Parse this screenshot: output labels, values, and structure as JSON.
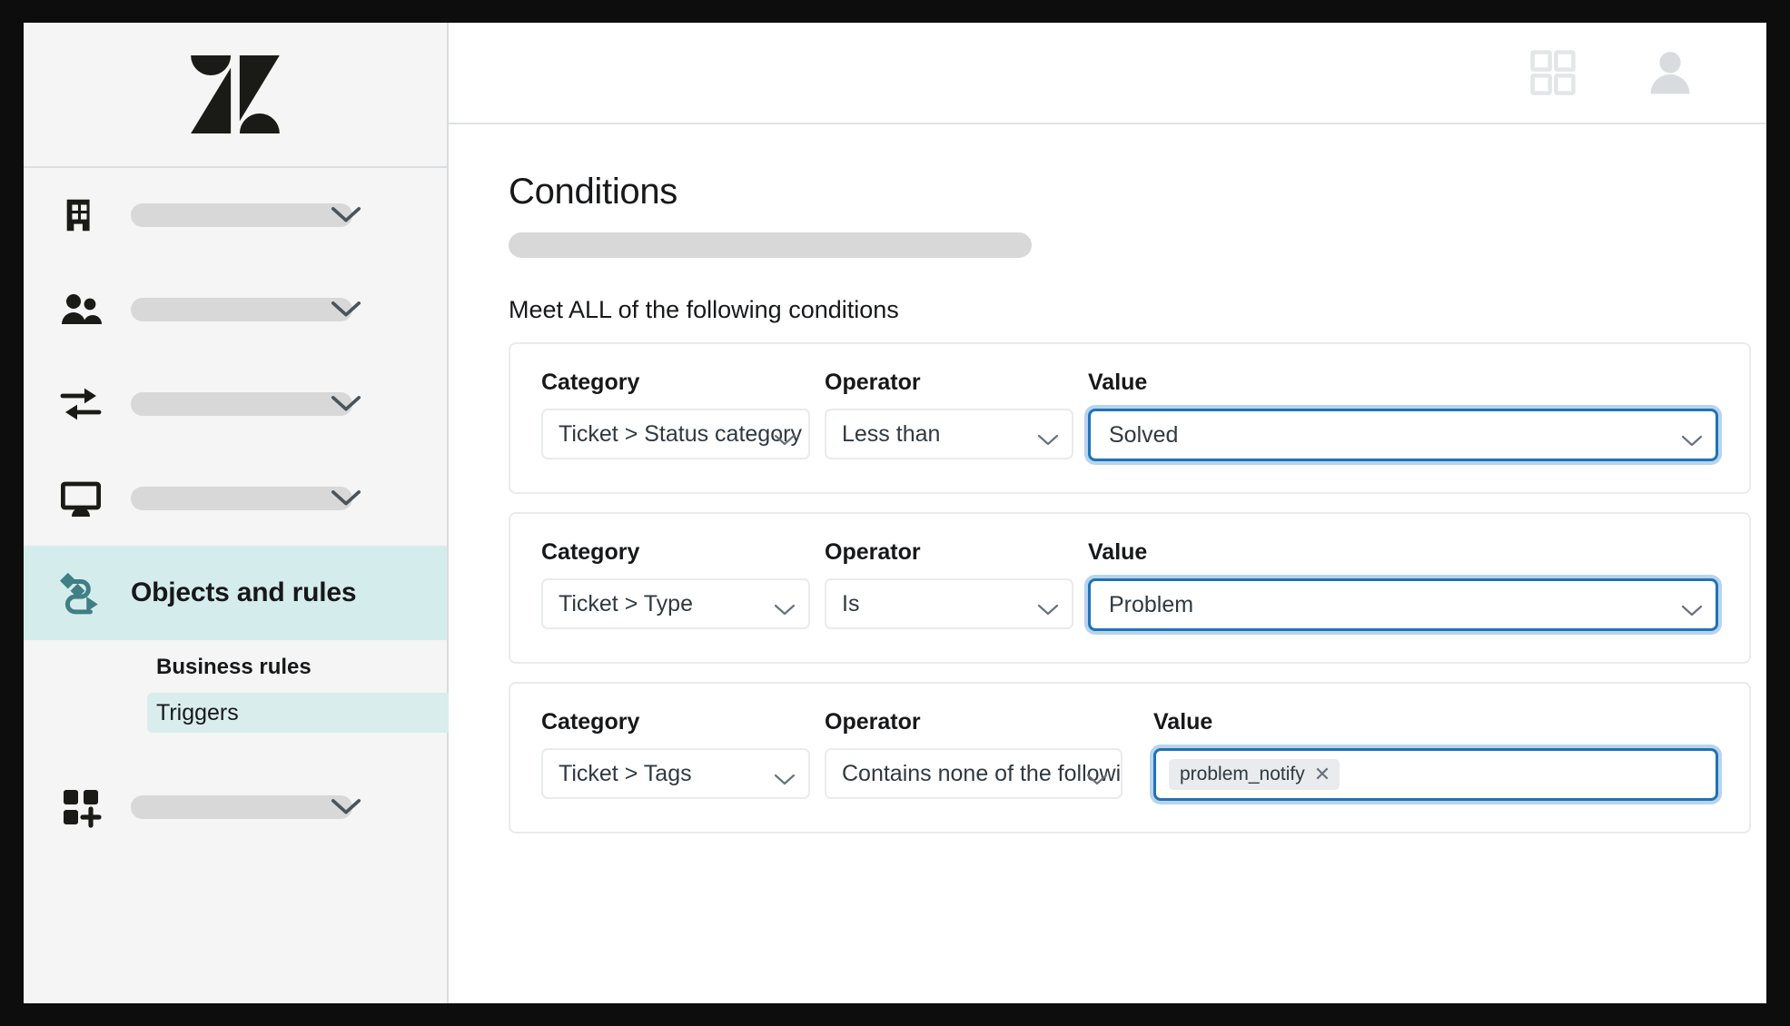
{
  "sidebar": {
    "logo": "zendesk-logo",
    "nav_items": [
      {
        "icon": "building-icon",
        "label": "",
        "skeleton": true,
        "chevron": true,
        "active": false
      },
      {
        "icon": "people-icon",
        "label": "",
        "skeleton": true,
        "chevron": true,
        "active": false
      },
      {
        "icon": "transfer-arrows-icon",
        "label": "",
        "skeleton": true,
        "chevron": true,
        "active": false
      },
      {
        "icon": "monitor-icon",
        "label": "",
        "skeleton": true,
        "chevron": true,
        "active": false
      },
      {
        "icon": "objects-rules-icon",
        "label": "Objects and rules",
        "skeleton": false,
        "chevron": false,
        "active": true
      },
      {
        "icon": "apps-add-icon",
        "label": "",
        "skeleton": true,
        "chevron": true,
        "active": false
      }
    ],
    "subnav": {
      "heading": "Business rules",
      "items": [
        {
          "label": "Triggers",
          "active": true
        }
      ]
    }
  },
  "topbar": {
    "grid_icon": "grid-apps-icon",
    "avatar_icon": "user-avatar-icon"
  },
  "main": {
    "page_title": "Conditions",
    "meet_all_label": "Meet ALL of the following conditions",
    "field_labels": {
      "category": "Category",
      "operator": "Operator",
      "value": "Value"
    },
    "conditions": [
      {
        "category": "Ticket > Status category",
        "operator": "Less than",
        "value": "Solved",
        "value_type": "select",
        "value_focused": true
      },
      {
        "category": "Ticket > Type",
        "operator": "Is",
        "value": "Problem",
        "value_type": "select",
        "value_focused": true
      },
      {
        "category": "Ticket > Tags",
        "operator": "Contains none of the following",
        "value": "problem_notify",
        "value_type": "tags",
        "value_focused": true
      }
    ]
  },
  "colors": {
    "accent_teal": "#d5eced",
    "subnav_active": "#d9edec",
    "focus_blue": "#1f73b7",
    "focus_ring": "#b8d4ec",
    "sidebar_bg": "#f5f5f5",
    "skeleton": "#d8d8d8",
    "border": "#e9ebed",
    "text": "#17181a"
  }
}
